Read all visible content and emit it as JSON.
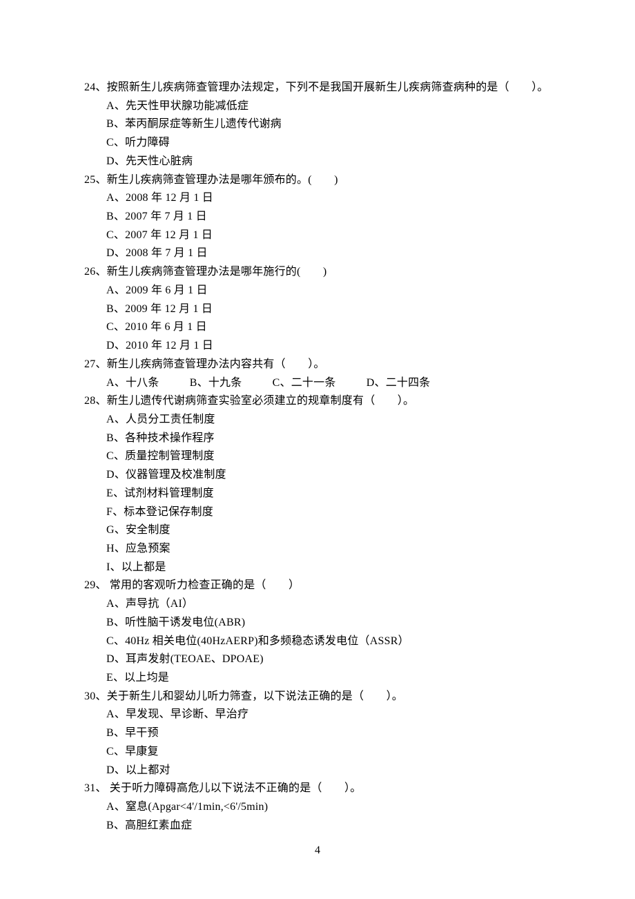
{
  "page_number": "4",
  "questions": [
    {
      "num": "24",
      "stem": "24、按照新生儿疾病筛查管理办法规定，下列不是我国开展新生儿疾病筛查病种的是（　　）。",
      "options": [
        "A、先天性甲状腺功能减低症",
        "B、苯丙酮尿症等新生儿遗传代谢病",
        "C、听力障碍",
        "D、先天性心脏病"
      ]
    },
    {
      "num": "25",
      "stem": "25、新生儿疾病筛查管理办法是哪年颁布的。(　　)",
      "options": [
        "A、2008 年 12 月 1 日",
        "B、2007 年 7 月 1 日",
        "C、2007 年 12 月 1 日",
        "D、2008 年 7 月 1 日"
      ]
    },
    {
      "num": "26",
      "stem": "26、新生儿疾病筛查管理办法是哪年施行的(　　)",
      "options": [
        "A、2009 年 6 月 1 日",
        "B、2009 年 12 月 1 日",
        "C、2010 年 6 月 1 日",
        "D、2010 年 12 月 1 日"
      ]
    },
    {
      "num": "27",
      "stem": "27、新生儿疾病筛查管理办法内容共有（　　）。",
      "inline": true,
      "options": [
        "A、十八条",
        "B、十九条",
        "C、二十一条",
        "D、二十四条"
      ]
    },
    {
      "num": "28",
      "stem": "28、新生儿遗传代谢病筛查实验室必须建立的规章制度有（　　）。",
      "options": [
        "A、人员分工责任制度",
        "B、各种技术操作程序",
        "C、质量控制管理制度",
        "D、仪器管理及校准制度",
        "E、试剂材料管理制度",
        "F、标本登记保存制度",
        "G、安全制度",
        "H、应急预案",
        "I、以上都是"
      ]
    },
    {
      "num": "29",
      "stem": "29、 常用的客观听力检查正确的是（　　）",
      "options": [
        "A、声导抗（AI）",
        "B、听性脑干诱发电位(ABR)",
        "C、40Hz 相关电位(40HzAERP)和多频稳态诱发电位（ASSR）",
        "D、耳声发射(TEOAE、DPOAE)",
        "E、以上均是"
      ]
    },
    {
      "num": "30",
      "stem": "30、关于新生儿和婴幼儿听力筛查，以下说法正确的是（　　）。",
      "options": [
        "A、早发现、早诊断、早治疗",
        "B、早干预",
        "C、早康复",
        "D、以上都对"
      ]
    },
    {
      "num": "31",
      "stem": "31、 关于听力障碍高危儿以下说法不正确的是（　　）。",
      "options": [
        "A、窒息(Apgar<4'/1min,<6'/5min)",
        "B、高胆红素血症"
      ]
    }
  ]
}
